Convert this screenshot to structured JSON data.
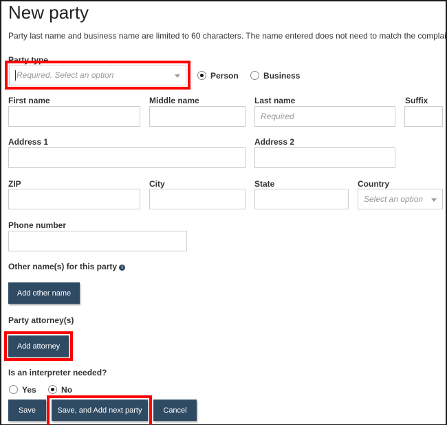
{
  "page": {
    "title": "New party",
    "intro": "Party last name and business name are limited to 60 characters. The name entered does not need to match the complaint."
  },
  "party_type": {
    "label": "Party type",
    "placeholder": "Required. Select an option",
    "options": [
      {
        "label": "Person",
        "selected": true
      },
      {
        "label": "Business",
        "selected": false
      }
    ]
  },
  "fields": {
    "first_name": {
      "label": "First name",
      "value": "",
      "placeholder": ""
    },
    "middle_name": {
      "label": "Middle name",
      "value": "",
      "placeholder": ""
    },
    "last_name": {
      "label": "Last name",
      "value": "",
      "placeholder": "Required"
    },
    "suffix": {
      "label": "Suffix",
      "value": "",
      "placeholder": ""
    },
    "address1": {
      "label": "Address 1",
      "value": "",
      "placeholder": ""
    },
    "address2": {
      "label": "Address 2",
      "value": "",
      "placeholder": ""
    },
    "zip": {
      "label": "ZIP",
      "value": "",
      "placeholder": ""
    },
    "city": {
      "label": "City",
      "value": "",
      "placeholder": ""
    },
    "state": {
      "label": "State",
      "value": "",
      "placeholder": ""
    },
    "country": {
      "label": "Country",
      "placeholder": "Select an option"
    },
    "phone": {
      "label": "Phone number",
      "value": "",
      "placeholder": ""
    }
  },
  "other_names": {
    "label": "Other name(s) for this party",
    "info_icon": "info-circle-icon",
    "button": "Add other name"
  },
  "attorneys": {
    "label": "Party attorney(s)",
    "button": "Add attorney"
  },
  "interpreter": {
    "label": "Is an interpreter needed?",
    "options": [
      {
        "label": "Yes",
        "selected": false
      },
      {
        "label": "No",
        "selected": true
      }
    ]
  },
  "actions": {
    "save": "Save",
    "save_next": "Save, and Add next party",
    "cancel": "Cancel"
  },
  "colors": {
    "button_bg": "#2f4a63",
    "highlight": "#ff0000",
    "border": "#cccccc"
  }
}
